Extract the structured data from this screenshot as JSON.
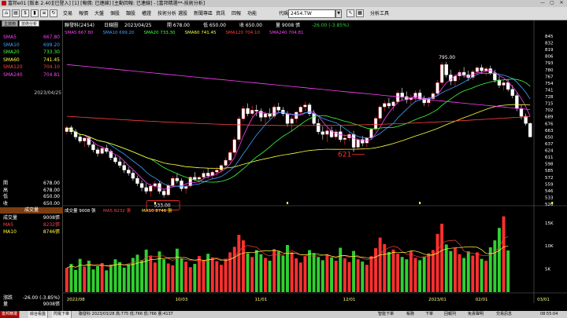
{
  "window": {
    "title": "富邦e01 [版本 2.40][已登入] [1] [報價: 已連線] [主動回報: 已連線] - [富邦精選**-技術分析]",
    "controls": [
      "—",
      "▢",
      "✕"
    ]
  },
  "toolbar": {
    "menus": [
      "交易",
      "報價",
      "大盤",
      "個股",
      "類股",
      "權證",
      "技術分析",
      "選股",
      "新聞專區",
      "資訊",
      "回報",
      "功能"
    ],
    "code_label": "代碼",
    "code_value": "2454.TW",
    "analysis_tools": "分析工具"
  },
  "sidebar": {
    "tabs": [
      "主技術",
      "技術分析"
    ],
    "sma_rows": [
      {
        "label": "SMA5",
        "value": "667.80",
        "color": "#ff40ff"
      },
      {
        "label": "SMA10",
        "value": "699.20",
        "color": "#40a0ff"
      },
      {
        "label": "SMA20",
        "value": "733.30",
        "color": "#40ff40"
      },
      {
        "label": "SMA60",
        "value": "741.45",
        "color": "#ffff40"
      },
      {
        "label": "SMA120",
        "value": "704.10",
        "color": "#ff4040"
      },
      {
        "label": "SMA240",
        "value": "704.81",
        "color": "#ff40ff"
      }
    ],
    "date": "2023/04/25",
    "ohlc": [
      {
        "label": "開",
        "value": "678.00"
      },
      {
        "label": "高",
        "value": "678.00"
      },
      {
        "label": "低",
        "value": "650.00"
      },
      {
        "label": "收",
        "value": "650.00"
      }
    ],
    "volume_header": "成交量",
    "volume_rows": [
      {
        "label": "成交量",
        "value": "9008張"
      },
      {
        "label": "MA5",
        "value": "8232張"
      },
      {
        "label": "MA10",
        "value": "8746張"
      }
    ],
    "change_label": "漲跌",
    "change_value": "-26.00 (-3.85%)",
    "qty_label": "量",
    "qty_value": "9008張"
  },
  "price_panel": {
    "header": {
      "stock": "聯發科(2454)",
      "period": "日線圖",
      "date": "2023/04/25",
      "open": "開 678.00",
      "low": "低 650.00",
      "close": "收 650.00",
      "vol": "量 9008 張",
      "change": "-26.00 (-3.85%)"
    },
    "sma_legend": [
      {
        "text": "SMA5 667.80",
        "color": "#ff40ff"
      },
      {
        "text": "SMA10 699.20",
        "color": "#40a0ff"
      },
      {
        "text": "SMA20 733.30",
        "color": "#40ff40"
      },
      {
        "text": "SMA60 741.45",
        "color": "#ffff40"
      },
      {
        "text": "SMA120 704.10",
        "color": "#ff4040"
      },
      {
        "text": "SMA240 704.81",
        "color": "#ff40ff"
      }
    ],
    "annotations": {
      "high": "795.00",
      "low": "533.00",
      "mid": "621"
    }
  },
  "volume_panel": {
    "legend": [
      {
        "text": "成交量 9008 張",
        "color": "#ffffff"
      },
      {
        "text": "MA5 8232 張",
        "color": "#ff4040"
      },
      {
        "text": "MA10 8746 張",
        "color": "#ffff40"
      }
    ]
  },
  "chart_data": {
    "type": "candlestick",
    "price_axis": [
      "845",
      "832",
      "819",
      "806",
      "793",
      "780",
      "767",
      "754",
      "741",
      "728",
      "715",
      "702",
      "689",
      "676",
      "663",
      "650",
      "637",
      "624",
      "611",
      "598",
      "585",
      "572",
      "559",
      "546",
      "533",
      "520"
    ],
    "price_ylim": [
      520,
      845
    ],
    "volume_axis": [
      "15K",
      "10K",
      "5K"
    ],
    "volume_ylim": [
      0,
      17000
    ],
    "x_labels": [
      "2022/08",
      "10/03",
      "11/01",
      "12/01",
      "2023/01",
      "02/01",
      "03/01",
      "04/06"
    ],
    "x_label_index": [
      0,
      26,
      44,
      64,
      84,
      94,
      108,
      128
    ],
    "candles": [
      [
        660,
        672,
        655,
        668
      ],
      [
        668,
        672,
        655,
        660
      ],
      [
        660,
        665,
        645,
        650
      ],
      [
        650,
        655,
        638,
        642
      ],
      [
        642,
        650,
        630,
        648
      ],
      [
        648,
        652,
        630,
        635
      ],
      [
        635,
        640,
        620,
        625
      ],
      [
        625,
        630,
        612,
        618
      ],
      [
        618,
        632,
        615,
        628
      ],
      [
        628,
        635,
        618,
        622
      ],
      [
        622,
        626,
        605,
        610
      ],
      [
        610,
        615,
        598,
        602
      ],
      [
        602,
        610,
        590,
        595
      ],
      [
        595,
        602,
        580,
        586
      ],
      [
        586,
        592,
        575,
        580
      ],
      [
        580,
        585,
        565,
        570
      ],
      [
        570,
        575,
        555,
        560
      ],
      [
        560,
        566,
        545,
        552
      ],
      [
        552,
        560,
        540,
        545
      ],
      [
        545,
        560,
        535,
        555
      ],
      [
        555,
        565,
        548,
        560
      ],
      [
        560,
        565,
        540,
        545
      ],
      [
        545,
        550,
        533,
        538
      ],
      [
        538,
        560,
        535,
        556
      ],
      [
        556,
        575,
        552,
        570
      ],
      [
        570,
        580,
        560,
        565
      ],
      [
        565,
        570,
        545,
        550
      ],
      [
        550,
        560,
        540,
        555
      ],
      [
        555,
        575,
        552,
        572
      ],
      [
        572,
        582,
        565,
        568
      ],
      [
        568,
        575,
        560,
        572
      ],
      [
        572,
        585,
        568,
        580
      ],
      [
        580,
        590,
        570,
        575
      ],
      [
        575,
        585,
        568,
        582
      ],
      [
        582,
        592,
        575,
        586
      ],
      [
        586,
        598,
        580,
        595
      ],
      [
        595,
        610,
        590,
        605
      ],
      [
        605,
        625,
        600,
        620
      ],
      [
        620,
        650,
        615,
        645
      ],
      [
        645,
        690,
        640,
        685
      ],
      [
        685,
        710,
        680,
        705
      ],
      [
        705,
        715,
        690,
        695
      ],
      [
        695,
        710,
        688,
        702
      ],
      [
        702,
        712,
        690,
        700
      ],
      [
        700,
        705,
        680,
        688
      ],
      [
        688,
        700,
        675,
        695
      ],
      [
        695,
        705,
        685,
        690
      ],
      [
        690,
        712,
        686,
        708
      ],
      [
        708,
        716,
        698,
        702
      ],
      [
        702,
        708,
        690,
        695
      ],
      [
        695,
        700,
        670,
        676
      ],
      [
        676,
        690,
        660,
        685
      ],
      [
        685,
        700,
        678,
        698
      ],
      [
        698,
        712,
        692,
        708
      ],
      [
        708,
        718,
        700,
        712
      ],
      [
        712,
        716,
        690,
        695
      ],
      [
        695,
        702,
        672,
        676
      ],
      [
        676,
        685,
        655,
        660
      ],
      [
        660,
        670,
        645,
        655
      ],
      [
        655,
        668,
        640,
        662
      ],
      [
        662,
        670,
        648,
        650
      ],
      [
        650,
        665,
        645,
        660
      ],
      [
        660,
        672,
        640,
        645
      ],
      [
        645,
        655,
        635,
        648
      ],
      [
        648,
        660,
        642,
        655
      ],
      [
        655,
        662,
        621,
        630
      ],
      [
        630,
        648,
        625,
        645
      ],
      [
        645,
        652,
        632,
        638
      ],
      [
        638,
        650,
        630,
        648
      ],
      [
        648,
        668,
        645,
        665
      ],
      [
        665,
        690,
        660,
        686
      ],
      [
        686,
        712,
        680,
        708
      ],
      [
        708,
        720,
        700,
        715
      ],
      [
        715,
        725,
        705,
        710
      ],
      [
        710,
        722,
        700,
        718
      ],
      [
        718,
        740,
        712,
        735
      ],
      [
        735,
        745,
        720,
        728
      ],
      [
        728,
        738,
        715,
        722
      ],
      [
        722,
        732,
        712,
        726
      ],
      [
        726,
        740,
        718,
        735
      ],
      [
        735,
        742,
        720,
        724
      ],
      [
        724,
        730,
        710,
        716
      ],
      [
        716,
        728,
        708,
        724
      ],
      [
        724,
        738,
        720,
        734
      ],
      [
        734,
        760,
        730,
        755
      ],
      [
        755,
        795,
        750,
        790
      ],
      [
        790,
        795,
        765,
        770
      ],
      [
        770,
        780,
        750,
        758
      ],
      [
        758,
        772,
        748,
        768
      ],
      [
        768,
        780,
        760,
        775
      ],
      [
        775,
        785,
        765,
        770
      ],
      [
        770,
        778,
        758,
        765
      ],
      [
        765,
        780,
        760,
        776
      ],
      [
        776,
        788,
        770,
        784
      ],
      [
        784,
        790,
        772,
        778
      ],
      [
        778,
        786,
        768,
        782
      ],
      [
        782,
        788,
        770,
        774
      ],
      [
        774,
        780,
        755,
        760
      ],
      [
        760,
        768,
        745,
        750
      ],
      [
        750,
        760,
        740,
        755
      ],
      [
        755,
        762,
        738,
        742
      ],
      [
        742,
        750,
        725,
        730
      ],
      [
        730,
        735,
        700,
        705
      ],
      [
        705,
        712,
        684,
        690
      ],
      [
        690,
        695,
        672,
        676
      ],
      [
        676,
        678,
        650,
        650
      ]
    ],
    "volumes": [
      5200,
      6100,
      4800,
      7200,
      5500,
      6800,
      4900,
      5600,
      6300,
      4700,
      5900,
      7100,
      6500,
      5300,
      6000,
      7400,
      8100,
      6900,
      9200,
      7800,
      6400,
      8800,
      7100,
      6200,
      5800,
      9400,
      7300,
      6600,
      5400,
      6100,
      7800,
      6900,
      8300,
      7500,
      6700,
      5900,
      7200,
      8600,
      9800,
      12400,
      11200,
      8400,
      7600,
      9100,
      8200,
      7400,
      6800,
      9300,
      8800,
      7900,
      10200,
      8600,
      7300,
      6400,
      7800,
      9100,
      8400,
      7600,
      6900,
      8200,
      7500,
      6800,
      9600,
      7300,
      6500,
      8900,
      7100,
      6600,
      5900,
      7800,
      9500,
      11800,
      10400,
      8700,
      9200,
      8300,
      7600,
      7100,
      8800,
      7400,
      6900,
      7700,
      8400,
      9100,
      12600,
      14800,
      10300,
      8900,
      9600,
      8200,
      7400,
      8800,
      7900,
      8600,
      7200,
      6800,
      9700,
      11200,
      13900,
      16400,
      9008
    ],
    "up_color": "#ff3030",
    "down_color": "#30d030"
  },
  "statusbar": {
    "tabs": [
      "富邦精選",
      "綜合看盤",
      "閃電下單"
    ],
    "info": "聯發科 2023/03/28 高:775 低:766 低:766 量:4137",
    "right_items": [
      "智能下單",
      "帳務",
      "下單",
      "回報列",
      "免責聲明",
      "交易訊息"
    ],
    "time": "08:55:04"
  }
}
